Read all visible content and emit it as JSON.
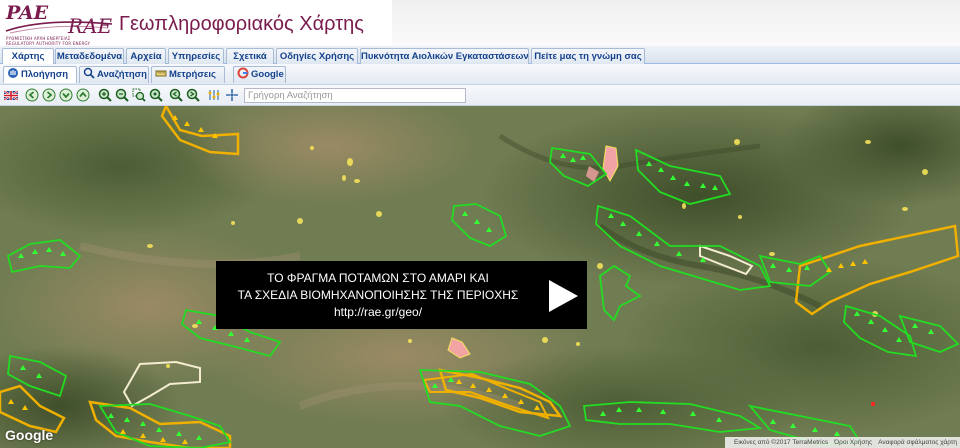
{
  "header": {
    "logo_main": "PAE",
    "logo_alt": "RAE",
    "logo_sub_greek": "ΡΥΘΜΙΣΤΙΚΗ ΑΡΧΗ ΕΝΕΡΓΕΙΑΣ",
    "logo_sub_english": "REGULATORY AUTHORITY FOR ENERGY",
    "title": "Γεωπληροφοριακός Χάρτης",
    "brand_color": "#7a1b4d"
  },
  "menu_tabs": [
    {
      "label": "Χάρτης",
      "active": true
    },
    {
      "label": "Μεταδεδομένα",
      "active": false
    },
    {
      "label": "Αρχεία",
      "active": false
    },
    {
      "label": "Υπηρεσίες",
      "active": false
    },
    {
      "label": "Σχετικά",
      "active": false
    },
    {
      "label": "Οδηγίες Χρήσης",
      "active": false
    },
    {
      "label": "Πυκνότητα Αιολικών Εγκαταστάσεων",
      "active": false
    },
    {
      "label": "Πείτε μας τη γνώμη σας",
      "active": false
    }
  ],
  "sub_tabs": [
    {
      "label": "Πλοήγηση",
      "icon": "hand-icon",
      "active": true
    },
    {
      "label": "Αναζήτηση",
      "icon": "magnifier-icon",
      "active": false
    },
    {
      "label": "Μετρήσεις",
      "icon": "ruler-icon",
      "active": false
    },
    {
      "label": "Google",
      "icon": "google-icon",
      "active": false
    }
  ],
  "toolbar": {
    "icons": [
      "uk-flag-icon",
      "nav-left-icon",
      "nav-right-icon",
      "nav-down-icon",
      "nav-up-icon",
      "zoom-in-icon",
      "zoom-out-icon",
      "zoom-box-icon",
      "zoom-full-icon",
      "zoom-prev-icon",
      "zoom-next-icon",
      "layers-icon",
      "locate-icon"
    ],
    "search_placeholder": "Γρήγορη Αναζήτηση"
  },
  "video": {
    "line1": "ΤΟ ΦΡΑΓΜΑ ΠΟΤΑΜΩΝ ΣΤΟ ΑΜΑΡΙ ΚΑΙ",
    "line2": "ΤΑ ΣΧΕΔΙΑ ΒΙΟΜΗΧΑΝΟΠΟΙΗΣΗΣ ΤΗΣ ΠΕΡΙΟΧΗΣ",
    "line3": "http://rae.gr/geo/",
    "play": "play-icon"
  },
  "map": {
    "google_logo": "Google",
    "attribution": "Εικόνες από ©2017 TerraMetrics",
    "terms": "Όροι Χρήσης",
    "report": "Αναφορά σφάλματος χάρτη",
    "colors": {
      "green_zone": "#22dd22",
      "yellow_zone": "#f0b000",
      "pink_zone": "#f2a4a4",
      "yellow_spot": "#f4e25a"
    }
  }
}
